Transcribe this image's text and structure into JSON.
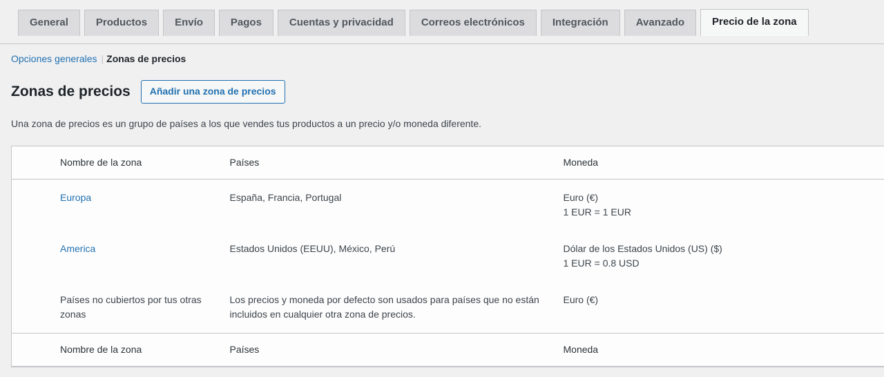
{
  "tabs": [
    {
      "label": "General",
      "active": false
    },
    {
      "label": "Productos",
      "active": false
    },
    {
      "label": "Envío",
      "active": false
    },
    {
      "label": "Pagos",
      "active": false
    },
    {
      "label": "Cuentas y privacidad",
      "active": false
    },
    {
      "label": "Correos electrónicos",
      "active": false
    },
    {
      "label": "Integración",
      "active": false
    },
    {
      "label": "Avanzado",
      "active": false
    },
    {
      "label": "Precio de la zona",
      "active": true
    }
  ],
  "breadcrumb": {
    "link_label": "Opciones generales",
    "separator": "|",
    "current_label": "Zonas de precios"
  },
  "page": {
    "title": "Zonas de precios",
    "add_button_label": "Añadir una zona de precios",
    "description": "Una zona de precios es un grupo de países a los que vendes tus productos a un precio y/o moneda diferente."
  },
  "table": {
    "columns": {
      "name": "Nombre de la zona",
      "countries": "Países",
      "currency": "Moneda"
    },
    "rows": [
      {
        "name": "Europa",
        "name_is_link": true,
        "countries": "España, Francia, Portugal",
        "currency": "Euro (€)",
        "rate": "1 EUR = 1 EUR"
      },
      {
        "name": "America",
        "name_is_link": true,
        "countries": "Estados Unidos (EEUU), México, Perú",
        "currency": "Dólar de los Estados Unidos (US) ($)",
        "rate": "1 EUR = 0.8 USD"
      },
      {
        "name": "Países no cubiertos por tus otras zonas",
        "name_is_link": false,
        "countries": "Los precios y moneda por defecto son usados para países que no están incluidos en cualquier otra zona de precios.",
        "currency": "Euro (€)",
        "rate": ""
      }
    ],
    "footer": {
      "name": "Nombre de la zona",
      "countries": "Países",
      "currency": "Moneda"
    }
  },
  "colors": {
    "link": "#2271b1",
    "page_bg": "#f0f0f1",
    "tab_active_bg": "#f6f7f7",
    "tab_bg": "#dcdcde",
    "border": "#c3c4c7"
  }
}
